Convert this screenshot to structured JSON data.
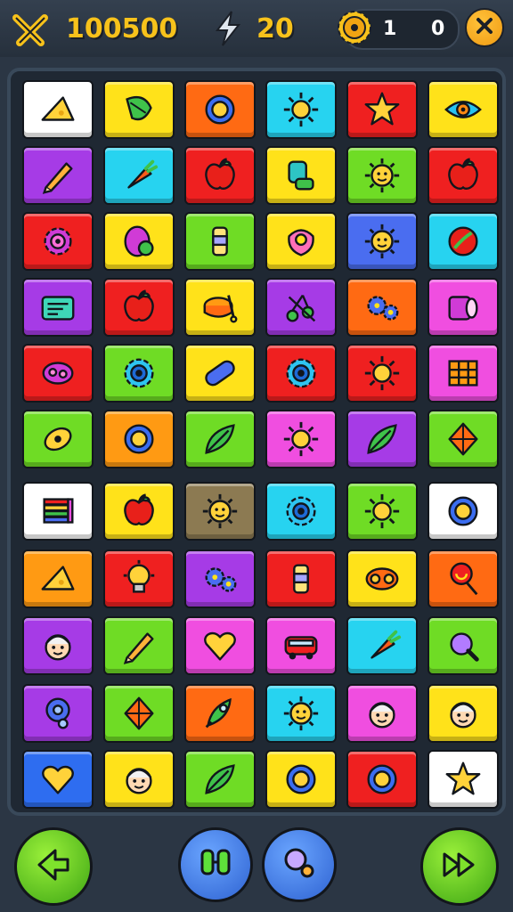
{
  "hud": {
    "score": "100500",
    "moves": "20",
    "coins_left": "1",
    "coins_right": "0",
    "score_icon": "crossed-swords-icon",
    "moves_icon": "lightning-bolt-icon",
    "coin_icon": "gear-coin-icon",
    "close_icon": "close-icon"
  },
  "colors": {
    "accent": "#f7c21b",
    "hud_bg": "#2b3644",
    "board_bg": "#1f2833"
  },
  "board": {
    "rows": [
      [
        {
          "color": "#ffffff",
          "icon": "cheese"
        },
        {
          "color": "#ffe21a",
          "icon": "leaf-pod"
        },
        {
          "color": "#ff6a13",
          "icon": "ring"
        },
        {
          "color": "#27d3f0",
          "icon": "sun"
        },
        {
          "color": "#ef2020",
          "icon": "star"
        },
        {
          "color": "#ffe21a",
          "icon": "eye"
        }
      ],
      [
        {
          "color": "#a63be6",
          "icon": "pencil"
        },
        {
          "color": "#27d3f0",
          "icon": "carrot"
        },
        {
          "color": "#ef2020",
          "icon": "apple"
        },
        {
          "color": "#ffe21a",
          "icon": "stamp"
        },
        {
          "color": "#6fdc25",
          "icon": "sun-face"
        },
        {
          "color": "#ef2020",
          "icon": "apple"
        }
      ],
      [
        {
          "color": "#ef2020",
          "icon": "gear-flower"
        },
        {
          "color": "#ffe21a",
          "icon": "egg"
        },
        {
          "color": "#6fdc25",
          "icon": "bottle"
        },
        {
          "color": "#ffe21a",
          "icon": "bagel"
        },
        {
          "color": "#4a6df0",
          "icon": "sun-face"
        },
        {
          "color": "#27d3f0",
          "icon": "ball"
        }
      ],
      [
        {
          "color": "#a63be6",
          "icon": "card"
        },
        {
          "color": "#ef2020",
          "icon": "apple"
        },
        {
          "color": "#ffe21a",
          "icon": "drum"
        },
        {
          "color": "#a63be6",
          "icon": "cherries"
        },
        {
          "color": "#ff6a13",
          "icon": "gears"
        },
        {
          "color": "#f04ee0",
          "icon": "mug"
        }
      ],
      [
        {
          "color": "#ef2020",
          "icon": "bean"
        },
        {
          "color": "#6fdc25",
          "icon": "gear"
        },
        {
          "color": "#ffe21a",
          "icon": "capsule"
        },
        {
          "color": "#ef2020",
          "icon": "gear"
        },
        {
          "color": "#ef2020",
          "icon": "sun"
        },
        {
          "color": "#f04ee0",
          "icon": "grid"
        }
      ],
      [
        {
          "color": "#6fdc25",
          "icon": "lemon"
        },
        {
          "color": "#ff9a13",
          "icon": "ring"
        },
        {
          "color": "#6fdc25",
          "icon": "leaf"
        },
        {
          "color": "#f04ee0",
          "icon": "sun"
        },
        {
          "color": "#a63be6",
          "icon": "leaf"
        },
        {
          "color": "#6fdc25",
          "icon": "kite"
        }
      ],
      [
        {
          "color": "#ffffff",
          "icon": "books"
        },
        {
          "color": "#ffe21a",
          "icon": "apple"
        },
        {
          "color": "#8c7a52",
          "icon": "sun-face"
        },
        {
          "color": "#27d3f0",
          "icon": "gear"
        },
        {
          "color": "#6fdc25",
          "icon": "sun"
        },
        {
          "color": "#ffffff",
          "icon": "ring"
        }
      ],
      [
        {
          "color": "#ff9a13",
          "icon": "cheese"
        },
        {
          "color": "#ef2020",
          "icon": "bulb"
        },
        {
          "color": "#a63be6",
          "icon": "gears"
        },
        {
          "color": "#ef2020",
          "icon": "bottle"
        },
        {
          "color": "#ffe21a",
          "icon": "mask"
        },
        {
          "color": "#ff6a13",
          "icon": "lollipop"
        }
      ],
      [
        {
          "color": "#a63be6",
          "icon": "face"
        },
        {
          "color": "#6fdc25",
          "icon": "pencil"
        },
        {
          "color": "#f04ee0",
          "icon": "heart"
        },
        {
          "color": "#f04ee0",
          "icon": "bus"
        },
        {
          "color": "#27d3f0",
          "icon": "carrot"
        },
        {
          "color": "#6fdc25",
          "icon": "magnifier"
        }
      ],
      [
        {
          "color": "#a63be6",
          "icon": "key"
        },
        {
          "color": "#6fdc25",
          "icon": "kite"
        },
        {
          "color": "#ff6a13",
          "icon": "rocket"
        },
        {
          "color": "#27d3f0",
          "icon": "sun-face"
        },
        {
          "color": "#f04ee0",
          "icon": "face"
        },
        {
          "color": "#ffe21a",
          "icon": "face"
        }
      ],
      [
        {
          "color": "#2e6df0",
          "icon": "heart"
        },
        {
          "color": "#ffe21a",
          "icon": "face"
        },
        {
          "color": "#6fdc25",
          "icon": "leaf"
        },
        {
          "color": "#ffe21a",
          "icon": "ring"
        },
        {
          "color": "#ef2020",
          "icon": "ring"
        },
        {
          "color": "#ffffff",
          "icon": "star"
        }
      ]
    ]
  },
  "controls": {
    "back_icon": "back-arrow-icon",
    "swap_icon": "swap-icon",
    "search_icon": "magnifier-icon",
    "next_icon": "fast-forward-icon"
  }
}
